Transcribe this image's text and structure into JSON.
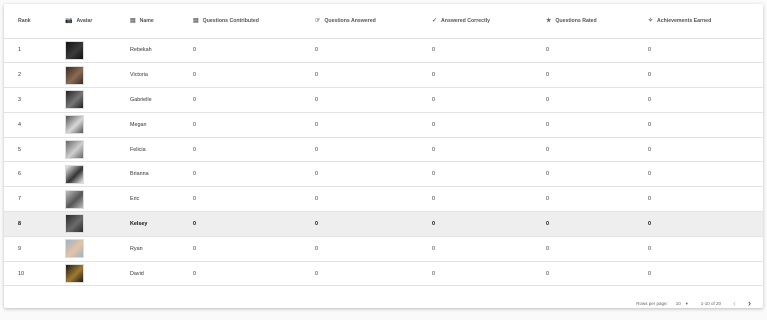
{
  "columns": [
    {
      "key": "rank",
      "label": "Rank",
      "icon": ""
    },
    {
      "key": "avatar",
      "label": "Avatar",
      "icon": "camera-icon"
    },
    {
      "key": "name",
      "label": "Name",
      "icon": "id-card-icon"
    },
    {
      "key": "contributed",
      "label": "Questions Contributed",
      "icon": "document-icon"
    },
    {
      "key": "answered",
      "label": "Questions Answered",
      "icon": "hand-point-icon"
    },
    {
      "key": "correct",
      "label": "Answered Correctly",
      "icon": "check-icon"
    },
    {
      "key": "rated",
      "label": "Questions Rated",
      "icon": "star-icon"
    },
    {
      "key": "achievements",
      "label": "Achievements Earned",
      "icon": "sparkle-icon"
    }
  ],
  "rows": [
    {
      "rank": "1",
      "name": "Rebekah",
      "contributed": "0",
      "answered": "0",
      "correct": "0",
      "rated": "0",
      "achievements": "0",
      "avatar_colors": [
        "#111",
        "#3a3a3a"
      ]
    },
    {
      "rank": "2",
      "name": "Victoria",
      "contributed": "0",
      "answered": "0",
      "correct": "0",
      "rated": "0",
      "achievements": "0",
      "avatar_colors": [
        "#3b2a22",
        "#8a6b54"
      ]
    },
    {
      "rank": "3",
      "name": "Gabrielle",
      "contributed": "0",
      "answered": "0",
      "correct": "0",
      "rated": "0",
      "achievements": "0",
      "avatar_colors": [
        "#222",
        "#777"
      ]
    },
    {
      "rank": "4",
      "name": "Megan",
      "contributed": "0",
      "answered": "0",
      "correct": "0",
      "rated": "0",
      "achievements": "0",
      "avatar_colors": [
        "#555",
        "#d8d8d8"
      ]
    },
    {
      "rank": "5",
      "name": "Felicia",
      "contributed": "0",
      "answered": "0",
      "correct": "0",
      "rated": "0",
      "achievements": "0",
      "avatar_colors": [
        "#666",
        "#cfcfcf"
      ]
    },
    {
      "rank": "6",
      "name": "Brianna",
      "contributed": "0",
      "answered": "0",
      "correct": "0",
      "rated": "0",
      "achievements": "0",
      "avatar_colors": [
        "#f0f0f0",
        "#333"
      ]
    },
    {
      "rank": "7",
      "name": "Eric",
      "contributed": "0",
      "answered": "0",
      "correct": "0",
      "rated": "0",
      "achievements": "0",
      "avatar_colors": [
        "#bdbdbd",
        "#555"
      ]
    },
    {
      "rank": "8",
      "name": "Kelsey",
      "contributed": "0",
      "answered": "0",
      "correct": "0",
      "rated": "0",
      "achievements": "0",
      "avatar_colors": [
        "#2a2a2a",
        "#6b6b6b"
      ],
      "highlighted": true
    },
    {
      "rank": "9",
      "name": "Ryan",
      "contributed": "0",
      "answered": "0",
      "correct": "0",
      "rated": "0",
      "achievements": "0",
      "avatar_colors": [
        "#9fb3c2",
        "#e3c3a8"
      ]
    },
    {
      "rank": "10",
      "name": "David",
      "contributed": "0",
      "answered": "0",
      "correct": "0",
      "rated": "0",
      "achievements": "0",
      "avatar_colors": [
        "#1a1a1a",
        "#a07a30"
      ]
    }
  ],
  "pagination": {
    "rows_per_page_label": "Rows per page:",
    "rows_per_page_value": "10",
    "range_text": "1-10 of 20"
  },
  "colors": {
    "highlight_row": "#eeeeee",
    "border": "#e3e3e3"
  }
}
